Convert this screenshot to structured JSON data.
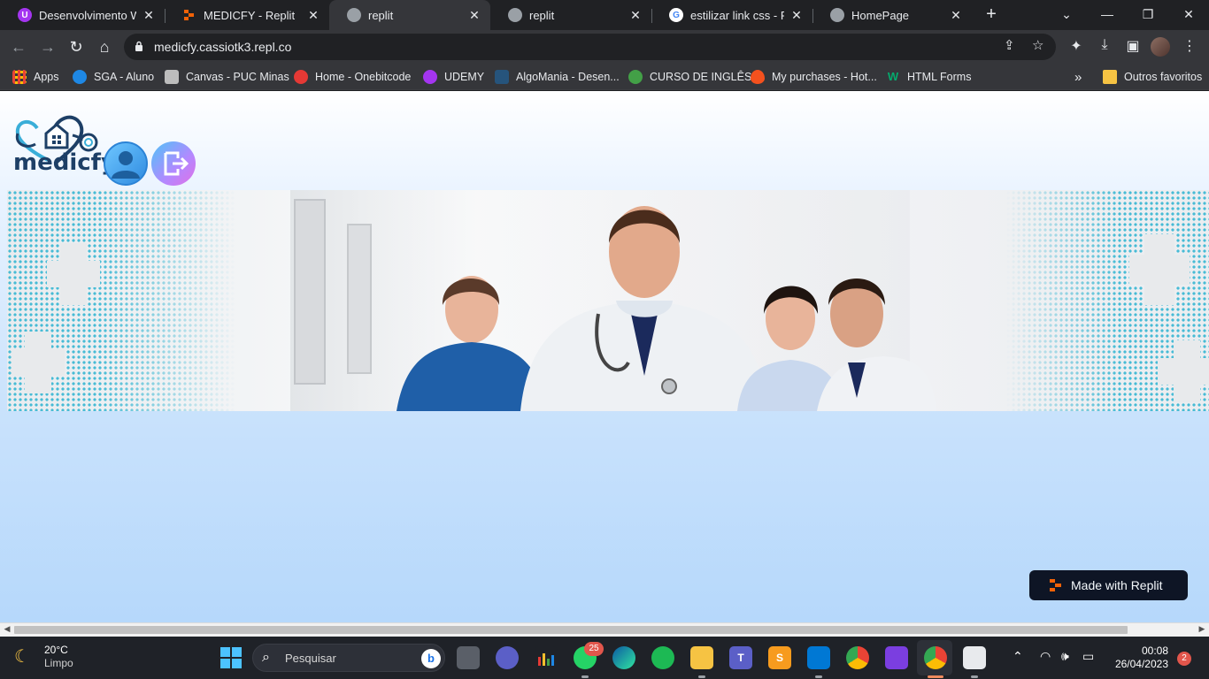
{
  "browser": {
    "tabs": [
      {
        "title": "Desenvolvimento Web",
        "favicon": "udemy-icon",
        "color": "#a435f0",
        "active": false
      },
      {
        "title": "MEDICFY - Replit",
        "favicon": "replit-icon",
        "color": "#f26207",
        "active": false
      },
      {
        "title": "replit",
        "favicon": "globe-icon",
        "color": "#9aa0a6",
        "active": true
      },
      {
        "title": "replit",
        "favicon": "globe-icon",
        "color": "#9aa0a6",
        "active": false
      },
      {
        "title": "estilizar link css - Pesq",
        "favicon": "google-icon",
        "color": "#4285f4",
        "active": false
      },
      {
        "title": "HomePage",
        "favicon": "globe-icon",
        "color": "#9aa0a6",
        "active": false
      }
    ],
    "new_tab_label": "+",
    "url": "medicfy.cassiotk3.repl.co",
    "bookmarks": [
      {
        "label": "Apps",
        "icon": "apps-grid-icon",
        "color": "#ea4335"
      },
      {
        "label": "SGA - Aluno",
        "icon": "sga-icon",
        "color": "#1e88e5"
      },
      {
        "label": "Canvas - PUC Minas",
        "icon": "canvas-icon",
        "color": "#9e9e9e"
      },
      {
        "label": "Home - Onebitcode",
        "icon": "onebitcode-icon",
        "color": "#e53935"
      },
      {
        "label": "UDEMY",
        "icon": "udemy-icon",
        "color": "#a435f0"
      },
      {
        "label": "AlgoMania - Desen...",
        "icon": "algomania-icon",
        "color": "#26547c"
      },
      {
        "label": "CURSO DE INGLÊS",
        "icon": "curso-icon",
        "color": "#43a047"
      },
      {
        "label": "My purchases - Hot...",
        "icon": "hotmart-icon",
        "color": "#f4511e"
      },
      {
        "label": "HTML Forms",
        "icon": "w3schools-icon",
        "color": "#04aa6d"
      }
    ],
    "more_bookmarks": "»",
    "other_favorites": "Outros favoritos"
  },
  "page": {
    "logo_text": "medicfy",
    "badge_text": "Made with Replit"
  },
  "taskbar": {
    "weather_temp": "20°C",
    "weather_desc": "Limpo",
    "search_placeholder": "Pesquisar",
    "whatsapp_badge": "25",
    "time": "00:08",
    "date": "26/04/2023",
    "notifications": "2"
  }
}
